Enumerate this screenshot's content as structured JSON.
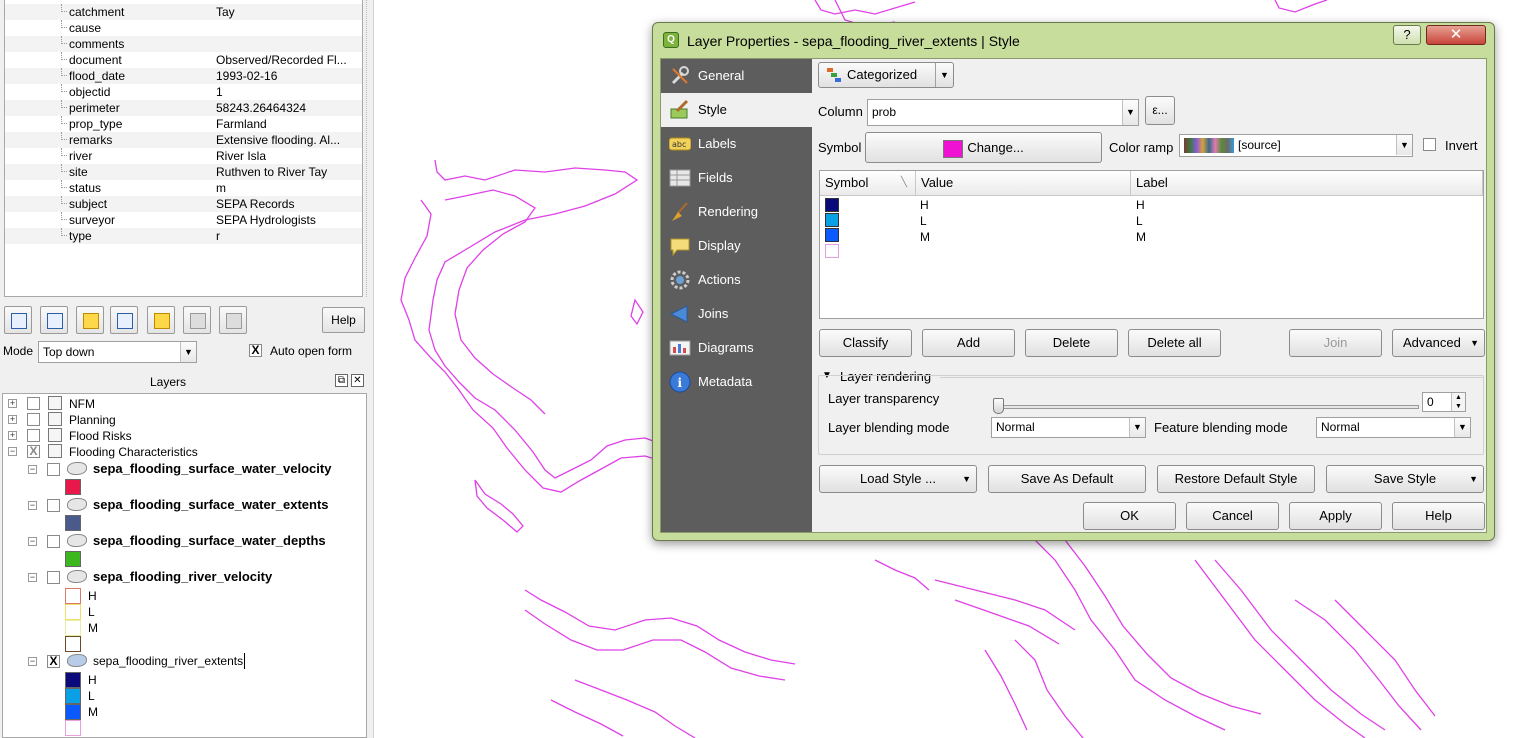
{
  "attributes": {
    "rows": [
      {
        "key": "catchment",
        "value": "Tay"
      },
      {
        "key": "cause",
        "value": ""
      },
      {
        "key": "comments",
        "value": ""
      },
      {
        "key": "document",
        "value": "Observed/Recorded Fl..."
      },
      {
        "key": "flood_date",
        "value": "1993-02-16"
      },
      {
        "key": "objectid",
        "value": "1"
      },
      {
        "key": "perimeter",
        "value": "58243.26464324"
      },
      {
        "key": "prop_type",
        "value": "Farmland"
      },
      {
        "key": "remarks",
        "value": "Extensive flooding.  Al..."
      },
      {
        "key": "river",
        "value": "River Isla"
      },
      {
        "key": "site",
        "value": "Ruthven to River Tay"
      },
      {
        "key": "status",
        "value": "m"
      },
      {
        "key": "subject",
        "value": "SEPA Records"
      },
      {
        "key": "surveyor",
        "value": "SEPA Hydrologists"
      },
      {
        "key": "type",
        "value": "r"
      }
    ]
  },
  "identify": {
    "help_label": "Help",
    "mode_label": "Mode",
    "mode_value": "Top down",
    "auto_open_label": "Auto open form",
    "auto_open_checked": "X"
  },
  "layers_panel": {
    "title": "Layers",
    "groups": [
      {
        "name": "NFM"
      },
      {
        "name": "Planning"
      },
      {
        "name": "Flood Risks"
      },
      {
        "name": "Flooding Characteristics",
        "checked": "X"
      }
    ],
    "layers": [
      {
        "name": "sepa_flooding_surface_water_velocity",
        "color": "#e8194a"
      },
      {
        "name": "sepa_flooding_surface_water_extents",
        "color": "#4a5a8a"
      },
      {
        "name": "sepa_flooding_surface_water_depths",
        "color": "#3cb81e"
      },
      {
        "name": "sepa_flooding_river_velocity",
        "classes": [
          {
            "label": "H",
            "color": "#d97a6a"
          },
          {
            "label": "L",
            "color": "#f0e06a"
          },
          {
            "label": "M",
            "color": "#e6f0a0"
          }
        ]
      },
      {
        "name": "sepa_flooding_river_extents",
        "checked": "X",
        "classes": [
          {
            "label": "H",
            "color": "#0a0a7a"
          },
          {
            "label": "L",
            "color": "#0aa0e6"
          },
          {
            "label": "M",
            "color": "#0a5aff"
          }
        ]
      }
    ]
  },
  "dialog": {
    "title": "Layer Properties - sepa_flooding_river_extents | Style",
    "help_glyph": "?",
    "close_glyph": "✕",
    "nav": [
      {
        "label": "General",
        "icon": "wrench-icon"
      },
      {
        "label": "Style",
        "icon": "paintbrush-icon"
      },
      {
        "label": "Labels",
        "icon": "abc-icon"
      },
      {
        "label": "Fields",
        "icon": "table-icon"
      },
      {
        "label": "Rendering",
        "icon": "broom-icon"
      },
      {
        "label": "Display",
        "icon": "speech-bubble-icon"
      },
      {
        "label": "Actions",
        "icon": "gear-icon"
      },
      {
        "label": "Joins",
        "icon": "megaphone-icon"
      },
      {
        "label": "Diagrams",
        "icon": "chart-icon"
      },
      {
        "label": "Metadata",
        "icon": "info-icon"
      }
    ],
    "renderer_type": "Categorized",
    "column_label": "Column",
    "column_value": "prob",
    "expression_glyph": "ε...",
    "symbol_label": "Symbol",
    "change_label": "Change...",
    "symbol_color": "#f012d2",
    "color_ramp_label": "Color ramp",
    "color_ramp_value": "[source]",
    "invert_label": "Invert",
    "table_headers": [
      "Symbol",
      "Value",
      "Label"
    ],
    "classes": [
      {
        "value": "H",
        "label": "H",
        "color": "#0a0a7a"
      },
      {
        "value": "L",
        "label": "L",
        "color": "#0aa0e6"
      },
      {
        "value": "M",
        "label": "M",
        "color": "#0a5aff"
      },
      {
        "value": "",
        "label": "",
        "color": "#ffffff"
      }
    ],
    "buttons": {
      "classify": "Classify",
      "add": "Add",
      "delete": "Delete",
      "delete_all": "Delete all",
      "join": "Join",
      "advanced": "Advanced"
    },
    "layer_rendering": {
      "title": "Layer rendering",
      "transparency_label": "Layer transparency",
      "transparency_value": "0",
      "blending_label": "Layer blending mode",
      "blending_value": "Normal",
      "feature_blending_label": "Feature blending mode",
      "feature_blending_value": "Normal"
    },
    "style_buttons": {
      "load": "Load Style ...",
      "save_default": "Save As Default",
      "restore_default": "Restore Default Style",
      "save": "Save Style"
    },
    "footer": {
      "ok": "OK",
      "cancel": "Cancel",
      "apply": "Apply",
      "help": "Help"
    }
  },
  "map": {
    "outline_color": "#e040e8"
  }
}
